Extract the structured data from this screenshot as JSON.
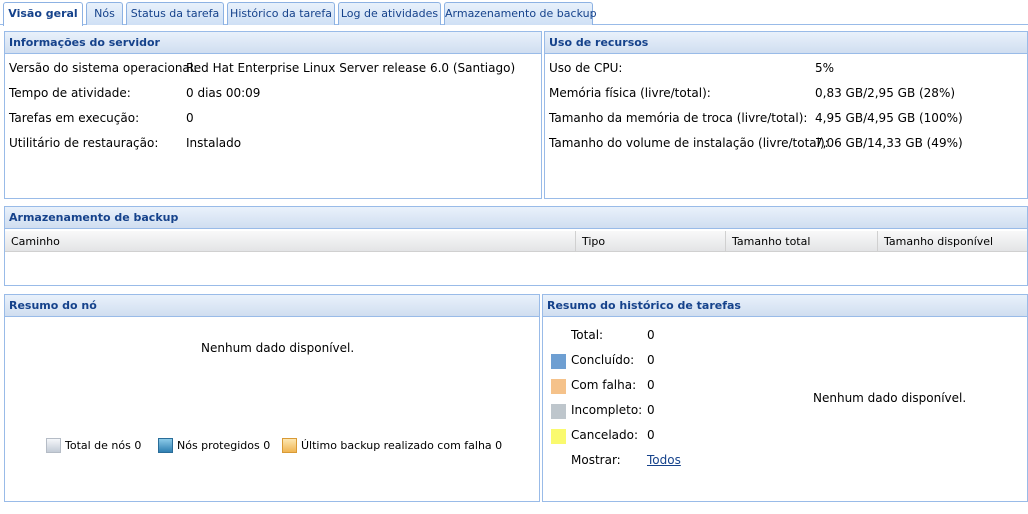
{
  "tabs": [
    {
      "label": "Visão geral"
    },
    {
      "label": "Nós"
    },
    {
      "label": "Status da tarefa"
    },
    {
      "label": "Histórico da tarefa"
    },
    {
      "label": "Log de atividades"
    },
    {
      "label": "Armazenamento de backup"
    }
  ],
  "server_info": {
    "title": "Informações do servidor",
    "rows": [
      {
        "label": "Versão do sistema operacional:",
        "value": "Red Hat Enterprise Linux Server release 6.0 (Santiago)"
      },
      {
        "label": "Tempo de atividade:",
        "value": "0 dias 00:09"
      },
      {
        "label": "Tarefas em execução:",
        "value": "0"
      },
      {
        "label": "Utilitário de restauração:",
        "value": "Instalado"
      }
    ]
  },
  "resources": {
    "title": "Uso de recursos",
    "rows": [
      {
        "label": "Uso de CPU:",
        "value": "5%"
      },
      {
        "label": "Memória física (livre/total):",
        "value": "0,83 GB/2,95 GB (28%)"
      },
      {
        "label": "Tamanho da memória de troca (livre/total):",
        "value": "4,95 GB/4,95 GB (100%)"
      },
      {
        "label": "Tamanho do volume de instalação (livre/total):",
        "value": "7,06 GB/14,33 GB (49%)"
      }
    ]
  },
  "backup_storage": {
    "title": "Armazenamento de backup",
    "columns": [
      "Caminho",
      "Tipo",
      "Tamanho total",
      "Tamanho disponível"
    ]
  },
  "node_summary": {
    "title": "Resumo do nó",
    "empty": "Nenhum dado disponível.",
    "legend": [
      {
        "label": "Total de nós 0"
      },
      {
        "label": "Nós protegidos 0"
      },
      {
        "label": "Último backup realizado com falha 0"
      }
    ]
  },
  "task_history": {
    "title": "Resumo do histórico de tarefas",
    "empty": "Nenhum dado disponível.",
    "total_label": "Total:",
    "total_value": "0",
    "items": [
      {
        "label": "Concluído:",
        "value": "0",
        "color": "#6e9fd2"
      },
      {
        "label": "Com falha:",
        "value": "0",
        "color": "#f5c28a"
      },
      {
        "label": "Incompleto:",
        "value": "0",
        "color": "#bec6cc"
      },
      {
        "label": "Cancelado:",
        "value": "0",
        "color": "#fafa6e"
      }
    ],
    "show_label": "Mostrar:",
    "show_link": "Todos"
  }
}
